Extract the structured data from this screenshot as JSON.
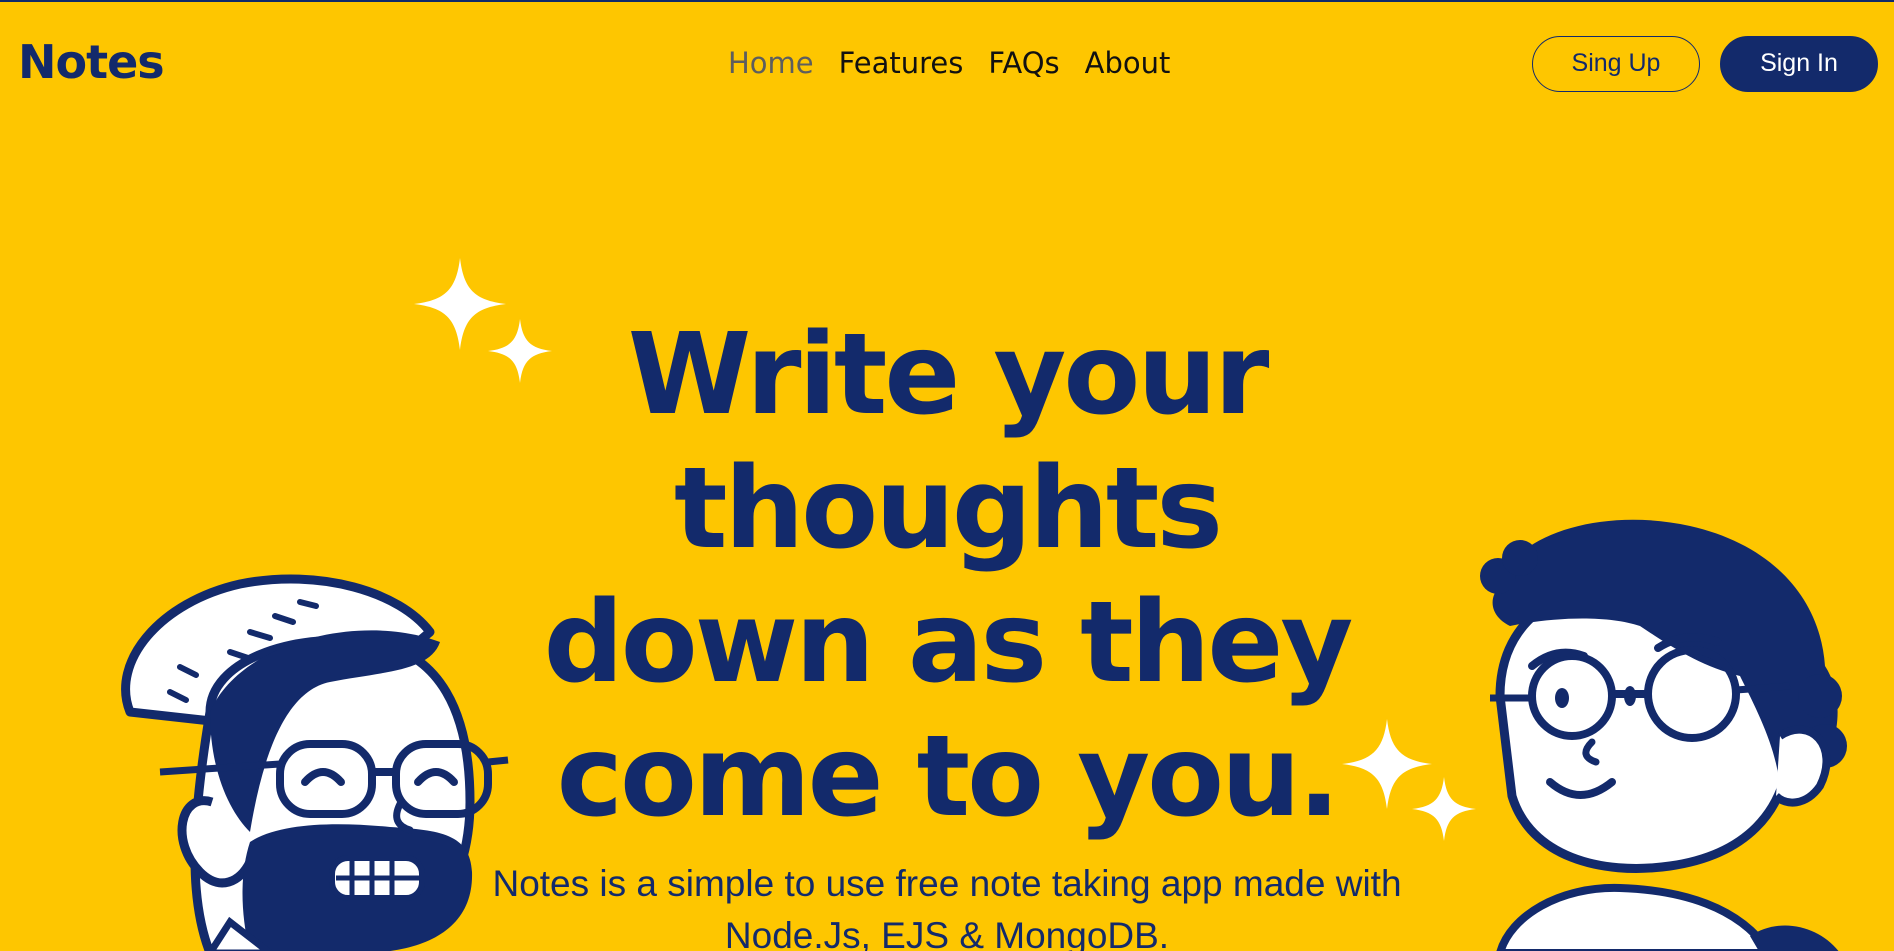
{
  "brand": {
    "logo_text": "Notes"
  },
  "nav": {
    "items": [
      {
        "label": "Home",
        "active": true
      },
      {
        "label": "Features",
        "active": false
      },
      {
        "label": "FAQs",
        "active": false
      },
      {
        "label": "About",
        "active": false
      }
    ]
  },
  "auth": {
    "signup_label": "Sing Up",
    "signin_label": "Sign In"
  },
  "hero": {
    "title_lines": [
      "Write your",
      "thoughts",
      "down as they",
      "come to you."
    ],
    "description": "Notes is a simple to use free note taking app made with Node.Js, EJS & MongoDB."
  },
  "colors": {
    "background": "#fec600",
    "brand_navy": "#132a6b",
    "sparkle": "#ffffff",
    "nav_active": "#5e5e5e"
  },
  "decorations": {
    "icons": [
      "sparkle-icon",
      "sparkle-icon",
      "sparkle-icon",
      "sparkle-icon"
    ],
    "illustrations": [
      "bearded-man-illustration",
      "curly-hair-person-illustration"
    ]
  }
}
